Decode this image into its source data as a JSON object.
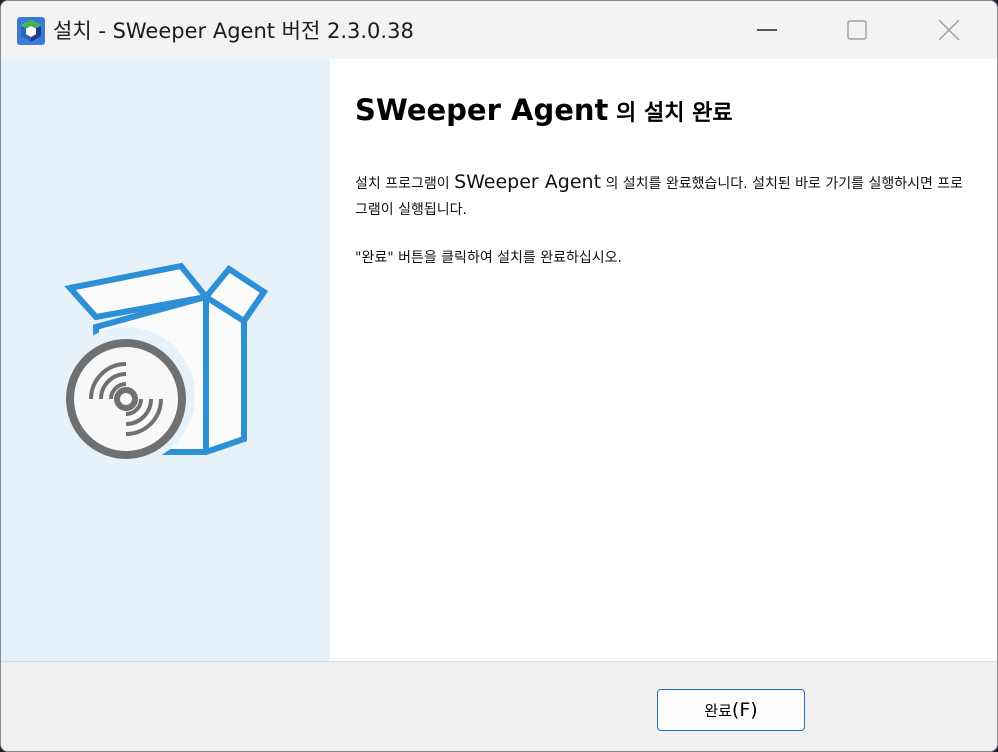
{
  "window": {
    "title": "설치 - SWeeper Agent 버전 2.3.0.38",
    "icons": {
      "app": "app-cube-icon",
      "minimize": "minimize-icon",
      "maximize": "maximize-icon",
      "close": "close-icon"
    }
  },
  "sidebar": {
    "illustration": "software-box-disc-icon",
    "colors": {
      "box": "#2d8fd5",
      "disc": "#707070",
      "panel": "#e7f1f9"
    }
  },
  "content": {
    "heading_main": "SWeeper Agent",
    "heading_suffix": " 의 설치 완료",
    "p1_before": "설치 프로그램이 ",
    "p1_app": "SWeeper Agent",
    "p1_after": " 의 설치를 완료했습니다. 설치된 바로 가기를 실행하시면 프로그램이 실행됩니다.",
    "p2": "\"완료\" 버튼을 클릭하여 설치를 완료하십시오."
  },
  "footer": {
    "finish_label": "완료",
    "finish_accel": "(F)",
    "accent_color": "#1f6fc4"
  }
}
